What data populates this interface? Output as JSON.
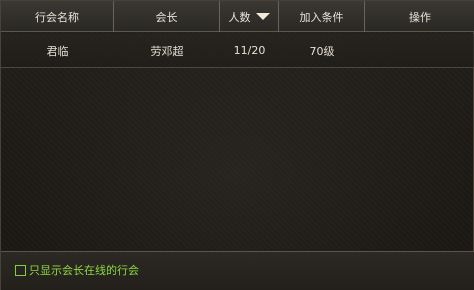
{
  "header": {
    "columns": [
      "行会名称",
      "会长",
      "人数",
      "加入条件",
      "操作"
    ]
  },
  "rows": [
    {
      "name": "君临",
      "leader": "劳邓超",
      "members": "11/20",
      "condition": "70级",
      "action": ""
    }
  ],
  "footer": {
    "checkbox_label": "只显示会长在线的行会",
    "checked": false
  },
  "colors": {
    "accent_green": "#8cdb3f",
    "header_text": "#e9e4d8"
  }
}
